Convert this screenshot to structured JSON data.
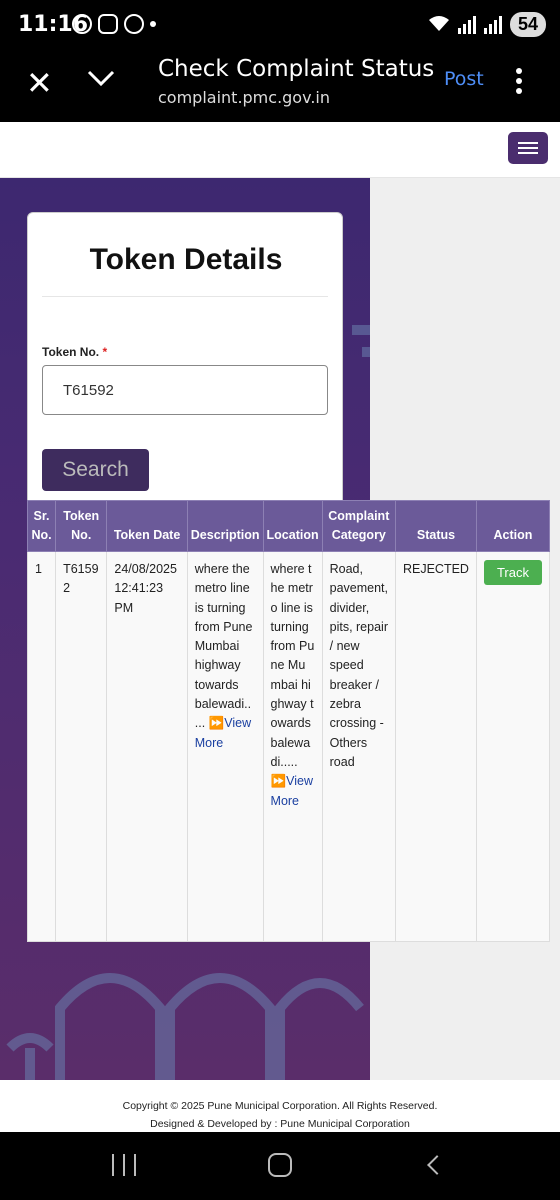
{
  "status_bar": {
    "time": "11:16",
    "battery": "54"
  },
  "browser": {
    "title": "Check Complaint Status",
    "url": "complaint.pmc.gov.in",
    "post_label": "Post"
  },
  "form": {
    "heading": "Token Details",
    "token_label": "Token No.",
    "required_mark": "*",
    "token_value": "T61592",
    "search_label": "Search"
  },
  "table": {
    "headers": [
      "Sr. No.",
      "Token No.",
      "Token Date",
      "Description",
      "Location",
      "Complaint Category",
      "Status",
      "Action"
    ],
    "rows": [
      {
        "sr": "1",
        "token": "T61592",
        "date": "24/08/2025 12:41:23 PM",
        "description": "where the metro line is turning from Pune Mumbai highway towards balewadi.. ...",
        "description_link": "View More",
        "location": "where the metro line is turning from Pune Mumbai highway towards balewadi.....",
        "location_link": "View More",
        "category": "Road, pavement, divider, pits, repair / new speed breaker / zebra crossing - Others road",
        "status": "REJECTED",
        "action": "Track"
      }
    ]
  },
  "footer": {
    "copyright": "Copyright © 2025 Pune Municipal Corporation. All Rights Reserved.",
    "designed": "Designed & Developed by : Pune Municipal Corporation"
  },
  "colors": {
    "brand_purple": "#4a2d6e",
    "header_purple": "#6b5a99",
    "track_green": "#4caf50"
  }
}
